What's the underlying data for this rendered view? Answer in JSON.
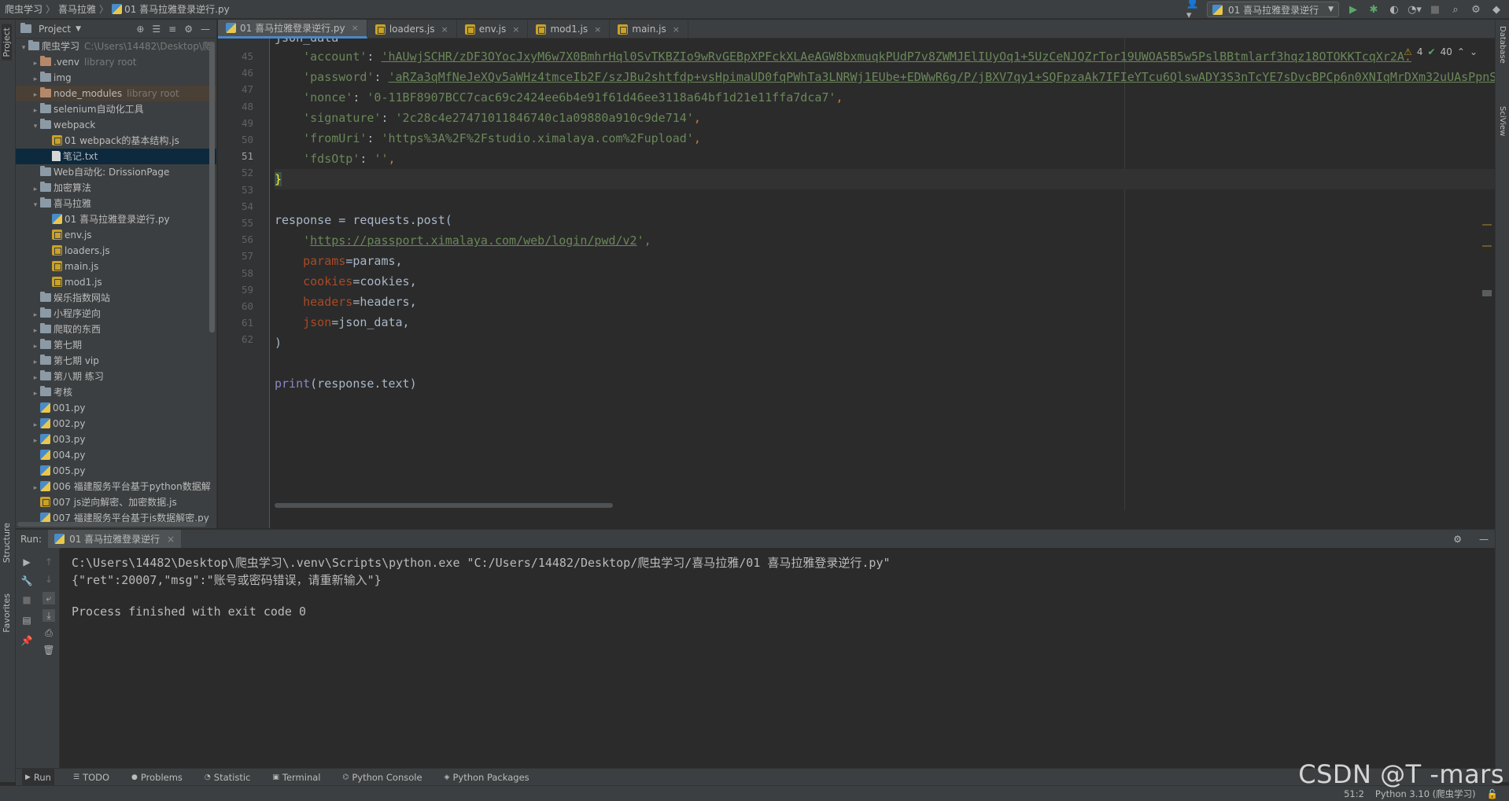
{
  "nav": {
    "crumbs": [
      "爬虫学习",
      "喜马拉雅",
      "01 喜马拉雅登录逆行.py"
    ]
  },
  "run_config": {
    "label": "01 喜马拉雅登录逆行"
  },
  "left_stripe": {
    "project": "Project",
    "structure": "Structure",
    "favorites": "Favorites"
  },
  "right_stripe": {
    "database": "Database",
    "sciview": "SciView"
  },
  "project": {
    "title": "Project",
    "tree": [
      {
        "label": "爬虫学习",
        "sub": "C:\\Users\\14482\\Desktop\\爬",
        "icon": "folder",
        "indent": 0,
        "arrow": "▾"
      },
      {
        "label": ".venv",
        "sub": "library root",
        "icon": "folder-excluded",
        "indent": 1,
        "arrow": "▸"
      },
      {
        "label": "img",
        "sub": "",
        "icon": "folder",
        "indent": 1,
        "arrow": "▸"
      },
      {
        "label": "node_modules",
        "sub": "library root",
        "icon": "folder-excluded",
        "indent": 1,
        "arrow": "▸",
        "highlight": true
      },
      {
        "label": "selenium自动化工具",
        "sub": "",
        "icon": "folder",
        "indent": 1,
        "arrow": "▸"
      },
      {
        "label": "webpack",
        "sub": "",
        "icon": "folder",
        "indent": 1,
        "arrow": "▾"
      },
      {
        "label": "01 webpack的基本结构.js",
        "sub": "",
        "icon": "js",
        "indent": 2,
        "arrow": ""
      },
      {
        "label": "笔记.txt",
        "sub": "",
        "icon": "txt",
        "indent": 2,
        "arrow": "",
        "selected": true
      },
      {
        "label": "Web自动化: DrissionPage",
        "sub": "",
        "icon": "folder",
        "indent": 1,
        "arrow": ""
      },
      {
        "label": "加密算法",
        "sub": "",
        "icon": "folder",
        "indent": 1,
        "arrow": "▸"
      },
      {
        "label": "喜马拉雅",
        "sub": "",
        "icon": "folder",
        "indent": 1,
        "arrow": "▾"
      },
      {
        "label": "01 喜马拉雅登录逆行.py",
        "sub": "",
        "icon": "py",
        "indent": 2,
        "arrow": ""
      },
      {
        "label": "env.js",
        "sub": "",
        "icon": "js",
        "indent": 2,
        "arrow": ""
      },
      {
        "label": "loaders.js",
        "sub": "",
        "icon": "js",
        "indent": 2,
        "arrow": ""
      },
      {
        "label": "main.js",
        "sub": "",
        "icon": "js",
        "indent": 2,
        "arrow": ""
      },
      {
        "label": "mod1.js",
        "sub": "",
        "icon": "js",
        "indent": 2,
        "arrow": ""
      },
      {
        "label": "娱乐指数网站",
        "sub": "",
        "icon": "folder",
        "indent": 1,
        "arrow": ""
      },
      {
        "label": "小程序逆向",
        "sub": "",
        "icon": "folder",
        "indent": 1,
        "arrow": "▸"
      },
      {
        "label": "爬取的东西",
        "sub": "",
        "icon": "folder",
        "indent": 1,
        "arrow": "▸"
      },
      {
        "label": "第七期",
        "sub": "",
        "icon": "folder",
        "indent": 1,
        "arrow": "▸"
      },
      {
        "label": "第七期 vip",
        "sub": "",
        "icon": "folder",
        "indent": 1,
        "arrow": "▸"
      },
      {
        "label": "第八期 练习",
        "sub": "",
        "icon": "folder",
        "indent": 1,
        "arrow": "▸"
      },
      {
        "label": "考核",
        "sub": "",
        "icon": "folder",
        "indent": 1,
        "arrow": "▸"
      },
      {
        "label": "001.py",
        "sub": "",
        "icon": "py",
        "indent": 1,
        "arrow": ""
      },
      {
        "label": "002.py",
        "sub": "",
        "icon": "py",
        "indent": 1,
        "arrow": "▸"
      },
      {
        "label": "003.py",
        "sub": "",
        "icon": "py",
        "indent": 1,
        "arrow": "▸"
      },
      {
        "label": "004.py",
        "sub": "",
        "icon": "py",
        "indent": 1,
        "arrow": ""
      },
      {
        "label": "005.py",
        "sub": "",
        "icon": "py",
        "indent": 1,
        "arrow": ""
      },
      {
        "label": "006 福建服务平台基于python数据解",
        "sub": "",
        "icon": "py",
        "indent": 1,
        "arrow": "▸"
      },
      {
        "label": "007 js逆向解密、加密数据.js",
        "sub": "",
        "icon": "js",
        "indent": 1,
        "arrow": ""
      },
      {
        "label": "007 福建服务平台基于js数据解密.py",
        "sub": "",
        "icon": "py",
        "indent": 1,
        "arrow": ""
      }
    ]
  },
  "editor": {
    "tabs": [
      {
        "label": "01 喜马拉雅登录逆行.py",
        "icon": "py",
        "active": true
      },
      {
        "label": "loaders.js",
        "icon": "js",
        "active": false
      },
      {
        "label": "env.js",
        "icon": "js",
        "active": false
      },
      {
        "label": "mod1.js",
        "icon": "js",
        "active": false
      },
      {
        "label": "main.js",
        "icon": "js",
        "active": false
      }
    ],
    "inspection": {
      "warnings": "4",
      "weak": "40"
    },
    "line_numbers": [
      "45",
      "46",
      "47",
      "48",
      "49",
      "50",
      "51",
      "52",
      "53",
      "54",
      "55",
      "56",
      "57",
      "58",
      "59",
      "60",
      "61",
      "62"
    ],
    "current_line": "51",
    "partial_top": "json_data",
    "lines": {
      "l45_key": "'account'",
      "l45_val": "'hAUwjSCHR/zDF3OYocJxyM6w7X0BmhrHql0SvTKBZIo9wRvGEBpXPFckXLAeAGW8bxmuqkPUdP7v8ZWMJElIUyOq1+5UzCeNJQZrTor19UWOA5B5w5PslBBtmlarf3hqz18OTOKKTcqXr2A.",
      "l46_key": "'password'",
      "l46_val": "'aRZa3qMfNeJeXQv5aWHz4tmceIb2F/szJBu2shtfdp+vsHpimaUD0fqPWhTa3LNRWj1EUbe+EDWwR6g/P/jBXV7qy1+SQFpzaAk7IFIeYTcu6QlswADY3S3nTcYE7sDvcBPCp6n0XNIqMrDXm32uUAsPpnS",
      "l47_key": "'nonce'",
      "l47_val": "'0-11BF8907BCC7cac69c2424ee6b4e91f61d46ee3118a64bf1d21e11ffa7dca7'",
      "l48_key": "'signature'",
      "l48_val": "'2c28c4e27471011846740c1a09880a910c9de714'",
      "l49_key": "'fromUri'",
      "l49_val": "'https%3A%2F%2Fstudio.ximalaya.com%2Fupload'",
      "l50_key": "'fdsOtp'",
      "l50_val": "''",
      "l51": "}",
      "l53": "response = requests.post(",
      "l54_q1": "'",
      "l54_url": "https://passport.ximalaya.com/web/login/pwd/v2",
      "l54_q2": "',",
      "l55_p": "params",
      "l55_v": "=params,",
      "l56_p": "cookies",
      "l56_v": "=cookies,",
      "l57_p": "headers",
      "l57_v": "=headers,",
      "l58_p": "json",
      "l58_v": "=json_data,",
      "l59": ")",
      "l61_fn": "print",
      "l61_rest": "(response.text)"
    }
  },
  "run": {
    "label": "Run:",
    "tab": "01 喜马拉雅登录逆行",
    "output": [
      "C:\\Users\\14482\\Desktop\\爬虫学习\\.venv\\Scripts\\python.exe \"C:/Users/14482/Desktop/爬虫学习/喜马拉雅/01 喜马拉雅登录逆行.py\"",
      "{\"ret\":20007,\"msg\":\"账号或密码错误，请重新输入\"}",
      "",
      "Process finished with exit code 0"
    ]
  },
  "bottom_tabs": [
    {
      "label": "Run",
      "icon": "play-icon",
      "active": true
    },
    {
      "label": "TODO",
      "icon": "list-icon",
      "active": false
    },
    {
      "label": "Problems",
      "icon": "info-icon",
      "active": false
    },
    {
      "label": "Statistic",
      "icon": "stat-icon",
      "active": false
    },
    {
      "label": "Terminal",
      "icon": "terminal-icon",
      "active": false
    },
    {
      "label": "Python Console",
      "icon": "python-icon",
      "active": false
    },
    {
      "label": "Python Packages",
      "icon": "packages-icon",
      "active": false
    }
  ],
  "status": {
    "position": "51:2",
    "interpreter": "Python 3.10 (爬虫学习)"
  },
  "watermark": "CSDN @T -mars",
  "colors": {
    "accent": "#4a88c7",
    "string": "#6a8759",
    "keyword": "#cc7832",
    "param": "#aa4926",
    "builtin": "#8888c6",
    "run_green": "#59a869"
  }
}
